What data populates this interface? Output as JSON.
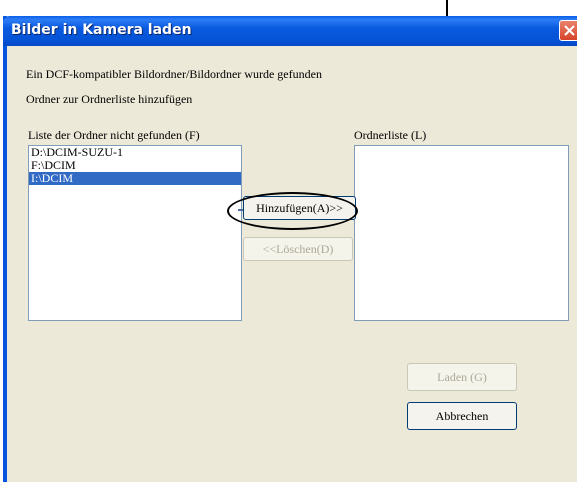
{
  "window": {
    "title": "Bilder in Kamera laden"
  },
  "messages": {
    "line1": "Ein DCF-kompatibler Bildordner/Bildordner wurde gefunden",
    "line2": "Ordner zur Ordnerliste hinzufügen"
  },
  "left_list": {
    "label": "Liste der Ordner nicht gefunden (F)",
    "items": [
      "D:\\DCIM-SUZU-1",
      "F:\\DCIM",
      "I:\\DCIM"
    ],
    "selected_index": 2
  },
  "right_list": {
    "label": "Ordnerliste (L)",
    "items": []
  },
  "buttons": {
    "add": "Hinzufügen(A)>>",
    "delete": "<<Löschen(D)",
    "load": "Laden (G)",
    "cancel": "Abbrechen"
  },
  "colors": {
    "titlebar": "#0853e0",
    "selection": "#316ac5",
    "dialog_bg": "#ece9d8"
  }
}
